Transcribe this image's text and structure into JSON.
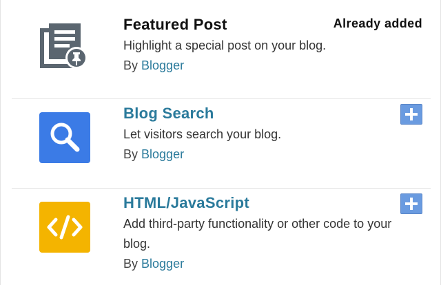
{
  "gadgets": [
    {
      "title": "Featured Post",
      "description": "Highlight a special post on your blog.",
      "author_prefix": "By",
      "author": "Blogger",
      "status": "Already added",
      "icon": "featured-post-icon",
      "icon_color": "#5b6670"
    },
    {
      "title": "Blog Search",
      "description": "Let visitors search your blog.",
      "author_prefix": "By",
      "author": "Blogger",
      "icon": "search-icon",
      "icon_color": "#3b7be6"
    },
    {
      "title": "HTML/JavaScript",
      "description": "Add third-party functionality or other code to your blog.",
      "author_prefix": "By",
      "author": "Blogger",
      "icon": "code-icon",
      "icon_color": "#f4b400"
    }
  ],
  "colors": {
    "link": "#2a7a9b",
    "add_button": "#6a9be0"
  }
}
